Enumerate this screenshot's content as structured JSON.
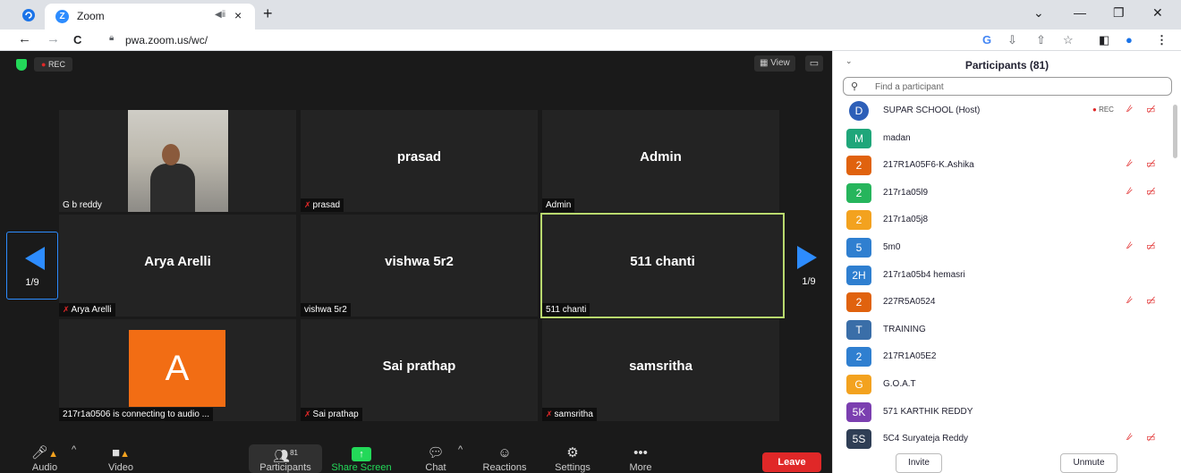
{
  "browser": {
    "tab_title": "Zoom",
    "url": "pwa.zoom.us/wc/",
    "new_tab": "+",
    "tab_close": "×",
    "tab_audio": "◀ⅱ",
    "back": "←",
    "forward": "→",
    "reload": "C",
    "minimize": "—",
    "restore": "❐",
    "close": "✕",
    "dropdown": "⌄",
    "toolbar_glyphs": {
      "google": "G",
      "install": "⇩",
      "share": "⇧",
      "bookmark": "☆",
      "sidepanel": "◧",
      "profile": "●",
      "menu": "⋮"
    }
  },
  "meeting": {
    "rec_label": "REC",
    "view_label": "View",
    "page_left": "1/9",
    "page_right": "1/9",
    "tiles": [
      {
        "name": "",
        "label": "G b reddy",
        "muted": false
      },
      {
        "name": "prasad",
        "label": "prasad",
        "muted": true
      },
      {
        "name": "Admin",
        "label": "Admin",
        "muted": false
      },
      {
        "name": "Arya Arelli",
        "label": "Arya Arelli",
        "muted": true
      },
      {
        "name": "vishwa 5r2",
        "label": "vishwa 5r2",
        "muted": false
      },
      {
        "name": "511 chanti",
        "label": "511 chanti",
        "muted": false
      },
      {
        "avatar_letter": "A",
        "label": "217r1a0506 is connecting to audio ...",
        "muted": false
      },
      {
        "name": "Sai prathap",
        "label": "Sai prathap",
        "muted": true
      },
      {
        "name": "samsritha",
        "label": "samsritha",
        "muted": true
      }
    ]
  },
  "toolbar": {
    "audio": "Audio",
    "video": "Video",
    "participants": "Participants",
    "participants_count": "81",
    "share": "Share Screen",
    "chat": "Chat",
    "reactions": "Reactions",
    "settings": "Settings",
    "more": "More",
    "leave": "Leave"
  },
  "panel": {
    "title": "Participants (81)",
    "search_placeholder": "Find a participant",
    "invite": "Invite",
    "unmute": "Unmute",
    "rec_label": "REC",
    "participants": [
      {
        "avatar": "D",
        "name": "SUPAR SCHOOL (Host)",
        "color": "#2d5fb8",
        "host": true,
        "rec": true,
        "muted": true,
        "video_off": true
      },
      {
        "avatar": "M",
        "name": "madan",
        "color": "#1fa67a",
        "muted": false,
        "video_off": false
      },
      {
        "avatar": "2",
        "name": "217R1A05F6-K.Ashika",
        "color": "#e0620e",
        "muted": true,
        "video_off": true
      },
      {
        "avatar": "2",
        "name": "217r1a05l9",
        "color": "#26b55c",
        "muted": true,
        "video_off": true
      },
      {
        "avatar": "2",
        "name": "217r1a05j8",
        "color": "#f3a21f",
        "muted": false,
        "video_off": false
      },
      {
        "avatar": "5",
        "name": "5m0",
        "color": "#2f7fd0",
        "muted": true,
        "video_off": true
      },
      {
        "avatar": "2H",
        "name": "217r1a05b4 hemasri",
        "color": "#2f7fd0",
        "muted": false,
        "video_off": false
      },
      {
        "avatar": "2",
        "name": "227R5A0524",
        "color": "#e0620e",
        "muted": true,
        "video_off": true
      },
      {
        "avatar": "T",
        "name": "TRAINING",
        "color": "#3a6ea8",
        "muted": false,
        "video_off": false
      },
      {
        "avatar": "2",
        "name": "217R1A05E2",
        "color": "#2f7fd0",
        "muted": false,
        "video_off": false
      },
      {
        "avatar": "G",
        "name": "G.O.A.T",
        "color": "#f3a21f",
        "muted": false,
        "video_off": false
      },
      {
        "avatar": "5K",
        "name": "571 KARTHIK REDDY",
        "color": "#7b3fb0",
        "muted": false,
        "video_off": false
      },
      {
        "avatar": "5S",
        "name": "5C4 Suryateja Reddy",
        "color": "#2f3e55",
        "muted": true,
        "video_off": true
      }
    ]
  },
  "icons": {
    "mic_muted": "🎤︎",
    "video_off": "📷︎",
    "search": "🔍︎",
    "mute_small": "⁄"
  }
}
